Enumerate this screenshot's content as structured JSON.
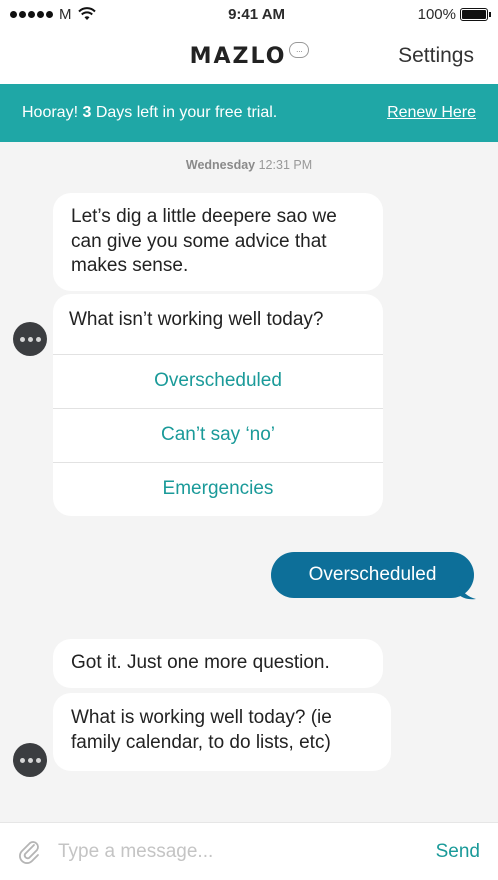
{
  "status_bar": {
    "carrier": "M",
    "time": "9:41 AM",
    "battery": "100%",
    "battery_level": 1.0
  },
  "nav": {
    "logo": "MAZLO",
    "logo_bubble": "...",
    "settings_label": "Settings"
  },
  "banner": {
    "prefix": "Hooray! ",
    "days": "3",
    "suffix": " Days left in your free trial.",
    "renew_label": "Renew Here"
  },
  "timestamp": {
    "day": "Wednesday",
    "time": "12:31 PM"
  },
  "messages": {
    "bot_intro": "Let’s dig a little deepere sao we can give you some advice that makes sense.",
    "question_card": {
      "question": "What isn’t working well today?",
      "options": [
        "Overscheduled",
        "Can’t say ‘no’",
        "Emergencies"
      ]
    },
    "user_reply": "Overscheduled",
    "bot_followup": "Got it. Just one more question.",
    "bot_question": "What is working well today? (ie family calendar, to do lists, etc)"
  },
  "composer": {
    "placeholder": "Type a message...",
    "send_label": "Send"
  },
  "colors": {
    "accent": "#1fa7a6",
    "user_bubble": "#0d6f99",
    "background": "#f4f4f4"
  }
}
